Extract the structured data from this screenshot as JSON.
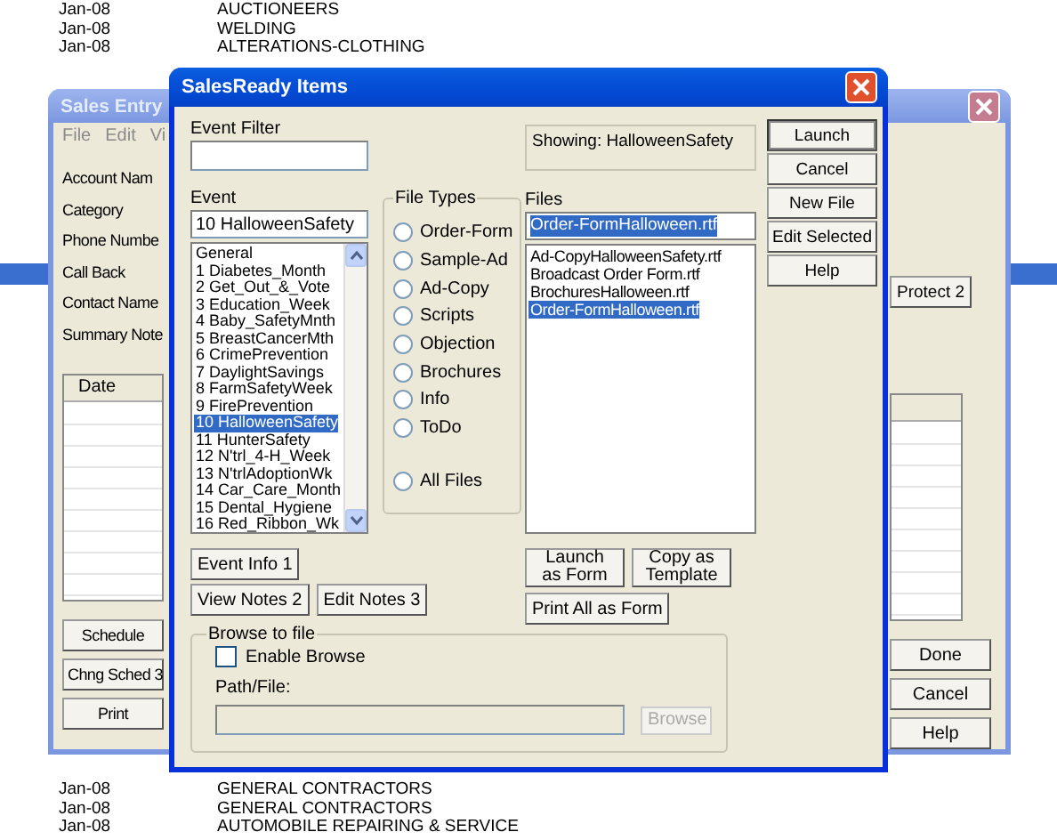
{
  "background_list": {
    "rows_top": [
      {
        "date": "Jan-08",
        "name": "AUCTIONEERS"
      },
      {
        "date": "Jan-08",
        "name": "WELDING"
      },
      {
        "date": "Jan-08",
        "name": "ALTERATIONS-CLOTHING"
      }
    ],
    "rows_bottom": [
      {
        "date": "Jan-08",
        "name": "GENERAL CONTRACTORS"
      },
      {
        "date": "Jan-08",
        "name": "GENERAL CONTRACTORS"
      },
      {
        "date": "Jan-08",
        "name": "AUTOMOBILE REPAIRING & SERVICE"
      }
    ]
  },
  "sales_entry": {
    "title": "Sales Entry",
    "menu": [
      "File",
      "Edit",
      "Vi"
    ],
    "fields": [
      "Account Nam",
      "Category",
      "Phone Numbe",
      "Call Back",
      "Contact Name",
      "Summary Note"
    ],
    "table": {
      "columns": [
        "Date"
      ]
    },
    "protect_button": "Protect 2",
    "left_buttons": [
      "Schedule",
      "Chng Sched 3",
      "Print"
    ],
    "right_buttons": [
      "Done",
      "Cancel",
      "Help"
    ]
  },
  "dialog": {
    "title": "SalesReady Items",
    "event_filter": {
      "label": "Event Filter"
    },
    "event": {
      "label": "Event",
      "value": "10 HalloweenSafety"
    },
    "events": [
      {
        "label": "General",
        "selected": false
      },
      {
        "label": "1 Diabetes_Month",
        "selected": false
      },
      {
        "label": "2 Get_Out_&_Vote",
        "selected": false
      },
      {
        "label": "3 Education_Week",
        "selected": false
      },
      {
        "label": "4 Baby_SafetyMnth",
        "selected": false
      },
      {
        "label": "5 BreastCancerMth",
        "selected": false
      },
      {
        "label": "6 CrimePrevention",
        "selected": false
      },
      {
        "label": "7 DaylightSavings",
        "selected": false
      },
      {
        "label": "8 FarmSafetyWeek",
        "selected": false
      },
      {
        "label": "9 FirePrevention",
        "selected": false
      },
      {
        "label": "10 HalloweenSafety",
        "selected": true
      },
      {
        "label": "11 HunterSafety",
        "selected": false
      },
      {
        "label": "12 N'trl_4-H_Week",
        "selected": false
      },
      {
        "label": "13 N'trlAdoptionWk",
        "selected": false
      },
      {
        "label": "14 Car_Care_Month",
        "selected": false
      },
      {
        "label": "15 Dental_Hygiene",
        "selected": false
      },
      {
        "label": "16 Red_Ribbon_Wk",
        "selected": false
      }
    ],
    "event_buttons": [
      "Event Info 1",
      "View Notes 2",
      "Edit Notes 3"
    ],
    "file_types": {
      "label": "File Types",
      "options": [
        {
          "label": "Order-Form",
          "selected": false
        },
        {
          "label": "Sample-Ad",
          "selected": false
        },
        {
          "label": "Ad-Copy",
          "selected": false
        },
        {
          "label": "Scripts",
          "selected": false
        },
        {
          "label": "Objection",
          "selected": false
        },
        {
          "label": "Brochures",
          "selected": false
        },
        {
          "label": "Info",
          "selected": false
        },
        {
          "label": "ToDo",
          "selected": false
        }
      ],
      "all_option": {
        "label": "All Files",
        "selected": false
      }
    },
    "showing": "Showing:  HalloweenSafety",
    "files": {
      "label": "Files",
      "value": "Order-FormHalloween.rtf",
      "value_highlighted": true,
      "items": [
        {
          "label": "Ad-CopyHalloweenSafety.rtf",
          "selected": false
        },
        {
          "label": "Broadcast Order Form.rtf",
          "selected": false
        },
        {
          "label": "BrochuresHalloween.rtf",
          "selected": false
        },
        {
          "label": "Order-FormHalloween.rtf",
          "selected": true
        }
      ]
    },
    "file_buttons": [
      "Launch as Form",
      "Copy as Template",
      "Print All as Form"
    ],
    "side_buttons": [
      {
        "label": "Launch",
        "default": true
      },
      {
        "label": "Cancel",
        "default": false
      },
      {
        "label": "New File",
        "default": false
      },
      {
        "label": "Edit Selected",
        "default": false
      },
      {
        "label": "Help",
        "default": false
      }
    ],
    "browse": {
      "label": "Browse to file",
      "enable": {
        "label": "Enable Browse",
        "checked": false
      },
      "path_label": "Path/File:",
      "path_disabled": true,
      "button": {
        "label": "Browse",
        "disabled": true
      }
    }
  }
}
